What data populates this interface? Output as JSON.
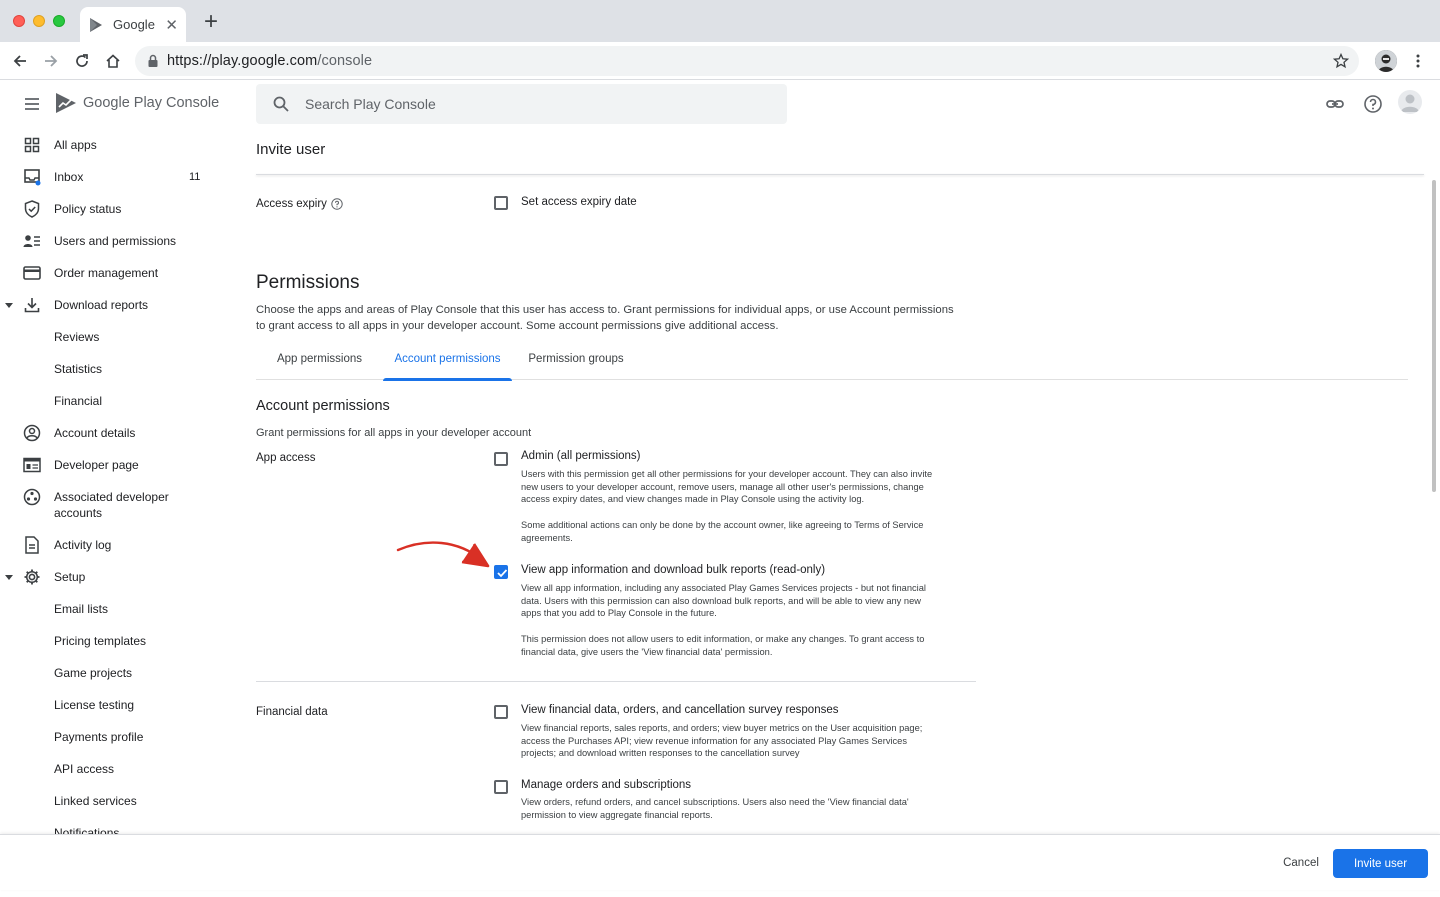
{
  "browser": {
    "tab_title": "Google",
    "url_host": "https://play.google.com",
    "url_path": "/console",
    "new_tab": "+",
    "close_tab": "✕"
  },
  "app": {
    "logo_text": "Google Play Console",
    "search_placeholder": "Search Play Console"
  },
  "sidebar": {
    "items": [
      {
        "label": "All apps",
        "icon": "grid-icon"
      },
      {
        "label": "Inbox",
        "icon": "inbox-icon",
        "badge": "11"
      },
      {
        "label": "Policy status",
        "icon": "shield-icon"
      },
      {
        "label": "Users and permissions",
        "icon": "users-icon"
      },
      {
        "label": "Order management",
        "icon": "credit-card-icon"
      },
      {
        "label": "Download reports",
        "icon": "download-icon"
      },
      {
        "label": "Reviews"
      },
      {
        "label": "Statistics"
      },
      {
        "label": "Financial"
      },
      {
        "label": "Account details",
        "icon": "account-circle-icon"
      },
      {
        "label": "Developer page",
        "icon": "web-page-icon"
      },
      {
        "label": "Associated developer accounts",
        "icon": "linked-accounts-icon"
      },
      {
        "label": "Activity log",
        "icon": "document-icon"
      },
      {
        "label": "Setup",
        "icon": "gear-icon"
      },
      {
        "label": "Email lists"
      },
      {
        "label": "Pricing templates"
      },
      {
        "label": "Game projects"
      },
      {
        "label": "License testing"
      },
      {
        "label": "Payments profile"
      },
      {
        "label": "API access"
      },
      {
        "label": "Linked services"
      },
      {
        "label": "Notifications"
      }
    ]
  },
  "main": {
    "page_title": "Invite user",
    "access_expiry": {
      "label": "Access expiry",
      "checkbox_label": "Set access expiry date",
      "checked": false
    },
    "permissions": {
      "title": "Permissions",
      "description_line1": "Choose the apps and areas of Play Console that this user has access to. Grant permissions for individual apps, or use Account permissions",
      "description_line2": "to grant access to all apps in your developer account. Some account permissions give additional access.",
      "tabs": [
        {
          "label": "App permissions",
          "active": false
        },
        {
          "label": "Account permissions",
          "active": true
        },
        {
          "label": "Permission groups",
          "active": false
        }
      ]
    },
    "account_permissions": {
      "title": "Account permissions",
      "description": "Grant permissions for all apps in your developer account",
      "app_access_label": "App access",
      "financial_label": "Financial data",
      "admin": {
        "label": "Admin (all permissions)",
        "checked": false,
        "desc": [
          "Users with this permission get all other permissions for your developer account. They can also invite",
          "new users to your developer account, remove users, manage all other user's permissions, change",
          "access expiry dates, and view changes made in Play Console using the activity log.",
          "",
          "Some additional actions can only be done by the account owner, like agreeing to Terms of Service",
          "agreements."
        ]
      },
      "view_app_info": {
        "label": "View app information and download bulk reports (read-only)",
        "checked": true,
        "desc": [
          "View all app information, including any associated Play Games Services projects - but not financial",
          "data. Users with this permission can also download bulk reports, and will be able to view any new",
          "apps that you add to Play Console in the future.",
          "",
          "This permission does not allow users to edit information, or make any changes. To grant access to",
          "financial data, give users the 'View financial data' permission."
        ]
      },
      "view_financial": {
        "label": "View financial data, orders, and cancellation survey responses",
        "checked": false,
        "desc": [
          "View financial reports, sales reports, and orders; view buyer metrics on the User acquisition page;",
          "access the Purchases API; view revenue information for any associated Play Games Services",
          "projects; and download written responses to the cancellation survey"
        ]
      },
      "manage_orders": {
        "label": "Manage orders and subscriptions",
        "checked": false,
        "desc": [
          "View orders, refund orders, and cancel subscriptions. Users also need the 'View financial data'",
          "permission to view aggregate financial reports."
        ]
      }
    }
  },
  "footer": {
    "cancel": "Cancel",
    "invite": "Invite user"
  },
  "colors": {
    "accent": "#1a73e8",
    "annotation_arrow": "#d93025"
  }
}
